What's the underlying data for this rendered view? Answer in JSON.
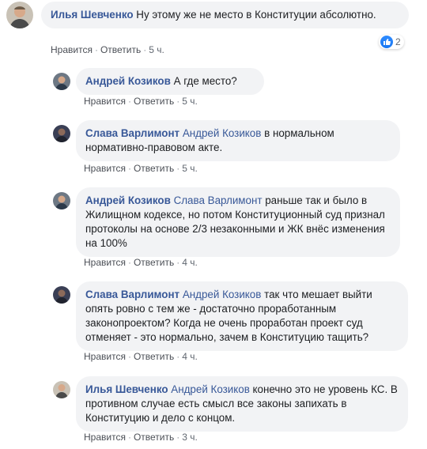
{
  "actions": {
    "like": "Нравится",
    "reply": "Ответить",
    "dot": "·"
  },
  "comments": [
    {
      "author": "Илья Шевченко",
      "mention": "",
      "text": "Ну этому же не место в Конституции абсолютно.",
      "time": "5 ч.",
      "reactions": "2",
      "avatar": "avatar-ilya"
    },
    {
      "author": "Андрей Козиков",
      "mention": "",
      "text": "А где место?",
      "time": "5 ч.",
      "avatar": "avatar-andrey"
    },
    {
      "author": "Слава Варлимонт",
      "mention": "Андрей Козиков",
      "text": "в нормальном нормативно-правовом акте.",
      "time": "5 ч.",
      "avatar": "avatar-slava"
    },
    {
      "author": "Андрей Козиков",
      "mention": "Слава Варлимонт",
      "text": "раньше так и было в Жилищном кодексе, но потом Конституционный суд признал протоколы на основе 2/3 незаконными и ЖК внёс изменения на 100%",
      "time": "4 ч.",
      "avatar": "avatar-andrey"
    },
    {
      "author": "Слава Варлимонт",
      "mention": "Андрей Козиков",
      "text": "так что мешает выйти опять ровно с тем же - достаточно проработанным законопроектом? Когда не очень проработан проект суд отменяет - это нормально, зачем в Конституцию тащить?",
      "time": "4 ч.",
      "avatar": "avatar-slava"
    },
    {
      "author": "Илья Шевченко",
      "mention": "Андрей Козиков",
      "text": "конечно это не уровень КС. В противном случае есть смысл все законы запихать в Конституцию и дело с концом.",
      "time": "3 ч.",
      "avatar": "avatar-ilya"
    }
  ]
}
